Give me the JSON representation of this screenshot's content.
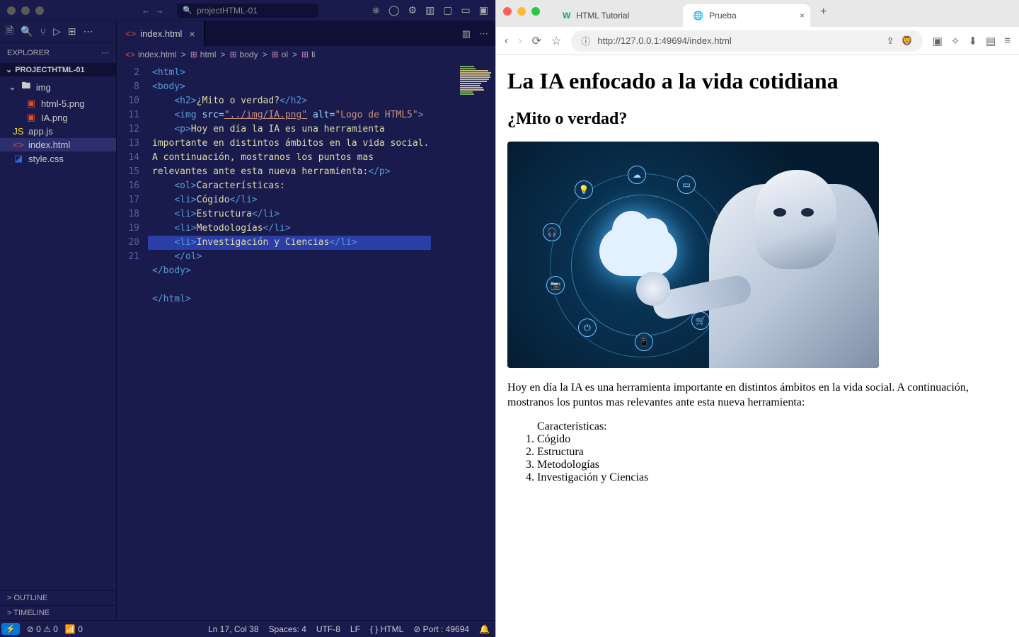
{
  "vscode": {
    "search_placeholder": "projectHTML-01",
    "explorer_label": "EXPLORER",
    "project_name": "PROJECTHTML-01",
    "tree": {
      "folder": "img",
      "img_files": [
        "html-5.png",
        "IA.png"
      ],
      "root_files": [
        "app.js",
        "index.html",
        "style.css"
      ],
      "active_file": "index.html"
    },
    "outline": "OUTLINE",
    "timeline": "TIMELINE",
    "tab": {
      "name": "index.html"
    },
    "breadcrumb": [
      "index.html",
      "html",
      "body",
      "ol",
      "li"
    ],
    "gutter": [
      "2",
      "8",
      "10",
      "11",
      "",
      "12",
      "",
      "",
      "",
      "",
      "13",
      "14",
      "15",
      "16",
      "17",
      "18",
      "19",
      "20",
      "21"
    ],
    "status": {
      "errors": "0",
      "warnings": "0",
      "radio": "0",
      "cursor": "Ln 17, Col 38",
      "spaces": "Spaces: 4",
      "encoding": "UTF-8",
      "eol": "LF",
      "lang": "HTML",
      "port": "Port : 49694"
    }
  },
  "code": {
    "l2": "<html>",
    "l8": "<body>",
    "l10_o": "    <h2>",
    "l10_t": "¿Mito o verdad?",
    "l10_c": "</h2>",
    "l11a": "    <img",
    "l11b": " src=",
    "l11c": "\"../img/IA.png\"",
    "l11d": " alt=",
    "l11e": "\"Logo de HTML5\"",
    "l11f": ">",
    "l12a": "    <p>",
    "l12t": "Hoy en día la IA es una herramienta importante en distintos ámbitos en la vida social. A continuación, mostranos los puntos mas relevantes ante esta nueva herramienta:",
    "l12c": "</p>",
    "l13a": "    <ol>",
    "l13t": "Características:",
    "l14a": "    <li>",
    "l14t": "Cógido",
    "l14c": "</li>",
    "l15a": "    <li>",
    "l15t": "Estructura",
    "l15c": "</li>",
    "l16a": "    <li>",
    "l16t": "Metodologías",
    "l16c": "</li>",
    "l17a": "    <li>",
    "l17t": "Investigación y Ciencias",
    "l17c": "</li>",
    "l18": "    </ol>",
    "l19": "</body>",
    "l21": "</html>"
  },
  "browser": {
    "tabs": [
      "HTML Tutorial",
      "Prueba"
    ],
    "url": "http://127.0.0.1:49694/index.html"
  },
  "page": {
    "h1": "La IA enfocado a la vida cotidiana",
    "h2": "¿Mito o verdad?",
    "paragraph": "Hoy en día la IA es una herramienta importante en distintos ámbitos en la vida social. A continuación, mostranos los puntos mas relevantes ante esta nueva herramienta:",
    "list_label": "Características:",
    "items": [
      "Cógido",
      "Estructura",
      "Metodologías",
      "Investigación y Ciencias"
    ]
  }
}
